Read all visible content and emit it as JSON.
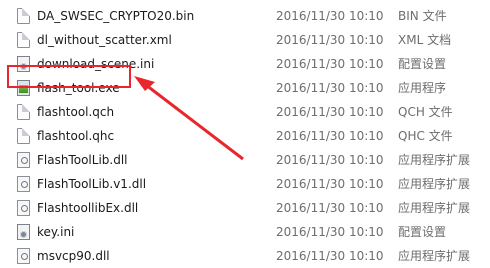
{
  "files": [
    {
      "name": "DA_SWSEC_CRYPTO20.bin",
      "date": "2016/11/30 10:10",
      "type": "BIN 文件",
      "icon": "doc",
      "icon_name": "file-icon"
    },
    {
      "name": "dl_without_scatter.xml",
      "date": "2016/11/30 10:10",
      "type": "XML 文档",
      "icon": "doc",
      "icon_name": "xml-file-icon"
    },
    {
      "name": "download_scene.ini",
      "date": "2016/11/30 10:10",
      "type": "配置设置",
      "icon": "ini",
      "icon_name": "settings-file-icon"
    },
    {
      "name": "flash_tool.exe",
      "date": "2016/11/30 10:10",
      "type": "应用程序",
      "icon": "exe",
      "icon_name": "application-icon"
    },
    {
      "name": "flashtool.qch",
      "date": "2016/11/30 10:10",
      "type": "QCH 文件",
      "icon": "doc",
      "icon_name": "file-icon"
    },
    {
      "name": "flashtool.qhc",
      "date": "2016/11/30 10:10",
      "type": "QHC 文件",
      "icon": "doc",
      "icon_name": "file-icon"
    },
    {
      "name": "FlashToolLib.dll",
      "date": "2016/11/30 10:10",
      "type": "应用程序扩展",
      "icon": "dll",
      "icon_name": "dll-file-icon"
    },
    {
      "name": "FlashToolLib.v1.dll",
      "date": "2016/11/30 10:10",
      "type": "应用程序扩展",
      "icon": "dll",
      "icon_name": "dll-file-icon"
    },
    {
      "name": "FlashtoollibEx.dll",
      "date": "2016/11/30 10:10",
      "type": "应用程序扩展",
      "icon": "dll",
      "icon_name": "dll-file-icon"
    },
    {
      "name": "key.ini",
      "date": "2016/11/30 10:10",
      "type": "配置设置",
      "icon": "ini",
      "icon_name": "settings-file-icon"
    },
    {
      "name": "msvcp90.dll",
      "date": "2016/11/30 10:10",
      "type": "应用程序扩展",
      "icon": "dll",
      "icon_name": "dll-file-icon"
    }
  ],
  "annotation": {
    "color": "#e8262b",
    "highlight_target": "flash_tool.exe"
  }
}
